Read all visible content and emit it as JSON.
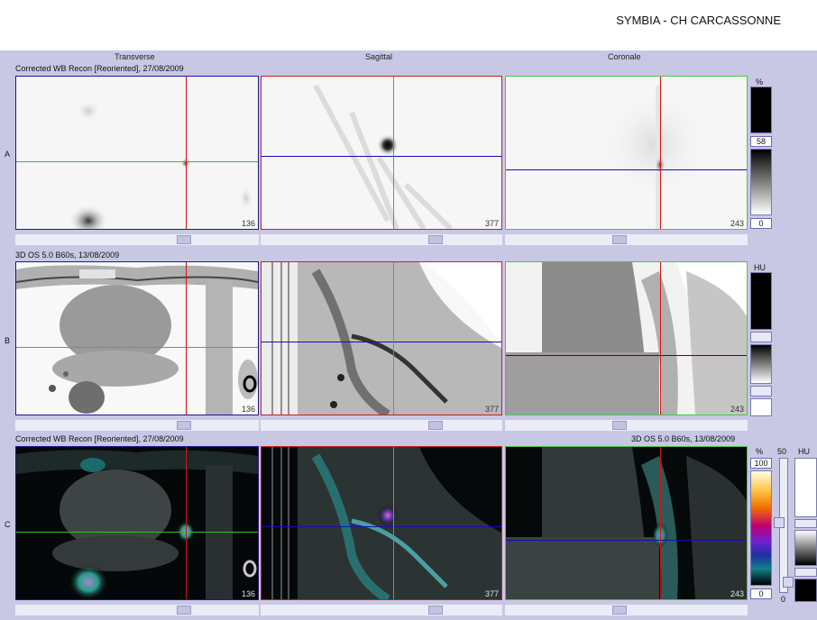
{
  "header": {
    "site": "SYMBIA - CH CARCASSONNE"
  },
  "columns": {
    "transverse": "Transverse",
    "sagittal": "Sagittal",
    "coronal": "Coronale"
  },
  "rows": {
    "a": {
      "label": "A",
      "caption": "Corrected WB Recon [Reoriented], 27/08/2009"
    },
    "b": {
      "label": "B",
      "caption": "3D  OS  5.0  B60s, 13/08/2009"
    },
    "c": {
      "label": "C",
      "caption_left": "Corrected WB Recon [Reoriented], 27/08/2009",
      "caption_right": "3D  OS  5.0  B60s, 13/08/2009"
    }
  },
  "slices": {
    "transverse": "136",
    "sagittal": "377",
    "coronal": "243"
  },
  "colorbars": {
    "a": {
      "unit": "%",
      "value": "58",
      "min": "0"
    },
    "b": {
      "unit": "HU"
    },
    "c": {
      "unit_left": "%",
      "max_left": "100",
      "min_left": "0",
      "unit_mid": "50",
      "min_mid": "0",
      "unit_right": "HU"
    }
  },
  "colors": {
    "crosshair_red": "#d81010",
    "crosshair_green": "#30c030",
    "crosshair_blue": "#1010b0",
    "frame_transverse": "#1a1a90",
    "frame_sagittal": "#c82020",
    "frame_coronal": "#50c050"
  }
}
